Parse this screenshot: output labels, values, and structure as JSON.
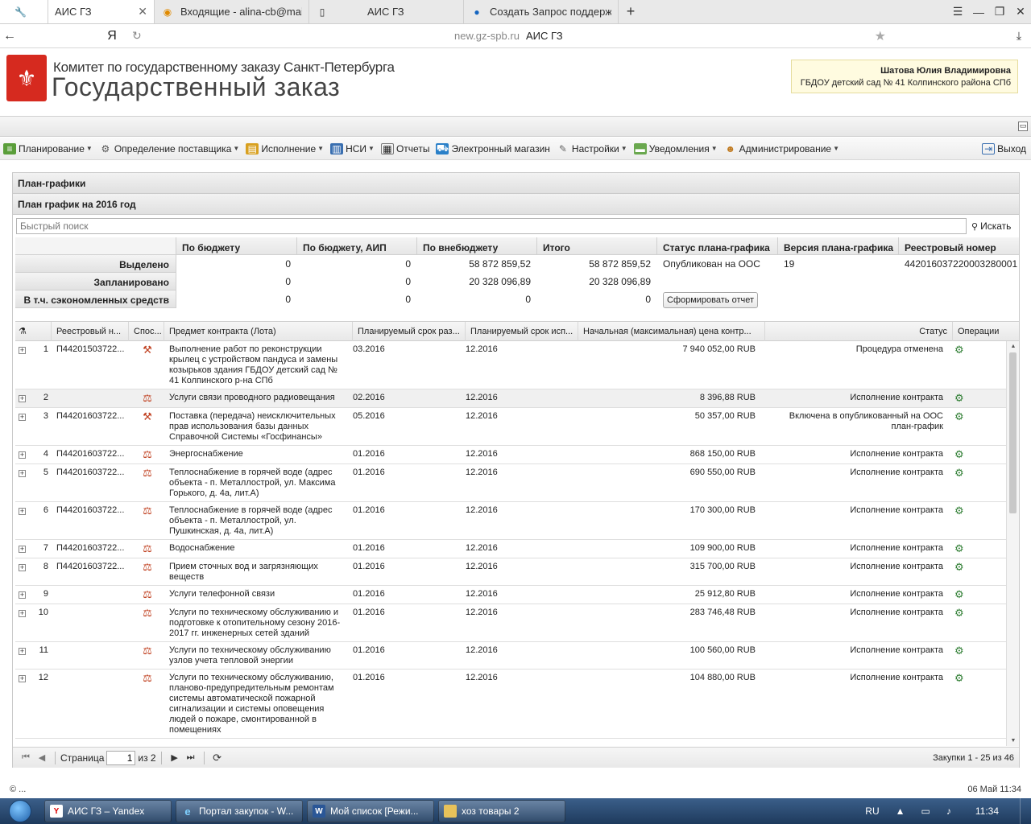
{
  "browser": {
    "tabs": [
      {
        "label": "АИС ГЗ",
        "icon": "wrench-icon",
        "active": true
      },
      {
        "label": "Входящие - alina-cb@mail.ru",
        "icon": "mail-icon"
      },
      {
        "label": "АИС ГЗ",
        "icon": "page-icon"
      },
      {
        "label": "Создать Запрос поддержки",
        "icon": "help-icon"
      }
    ],
    "yandex_glyph": "Я",
    "url_host": "new.gz-spb.ru",
    "url_title": "АИС ГЗ"
  },
  "header": {
    "org": "Комитет по государственному заказу Санкт-Петербурга",
    "brand": "Государственный заказ",
    "user_name": "Шатова Юлия Владимировна",
    "user_org": "ГБДОУ детский сад № 41 Колпинского района СПб"
  },
  "menu": {
    "items": [
      {
        "label": "Планирование",
        "icon": "planning-icon",
        "dropdown": true
      },
      {
        "label": "Определение поставщика",
        "icon": "supplier-icon",
        "dropdown": true
      },
      {
        "label": "Исполнение",
        "icon": "execution-icon",
        "dropdown": true
      },
      {
        "label": "НСИ",
        "icon": "book-icon",
        "dropdown": true
      },
      {
        "label": "Отчеты",
        "icon": "report-icon",
        "dropdown": false
      },
      {
        "label": "Электронный магазин",
        "icon": "cart-icon",
        "dropdown": false
      },
      {
        "label": "Настройки",
        "icon": "wrench-icon",
        "dropdown": true
      },
      {
        "label": "Уведомления",
        "icon": "notification-icon",
        "dropdown": true
      },
      {
        "label": "Администрирование",
        "icon": "user-icon",
        "dropdown": true
      }
    ],
    "exit_label": "Выход"
  },
  "panel": {
    "title": "План-графики",
    "subtitle": "План график на 2016 год",
    "search_placeholder": "Быстрый поиск",
    "search_button": "Искать"
  },
  "summary": {
    "headers": [
      "По бюджету",
      "По бюджету, АИП",
      "По внебюджету",
      "Итого",
      "Статус плана-графика",
      "Версия плана-графика",
      "Реестровый номер"
    ],
    "rows": [
      {
        "label": "Выделено",
        "values": [
          "0",
          "0",
          "58 872 859,52",
          "58 872 859,52"
        ]
      },
      {
        "label": "Запланировано",
        "values": [
          "0",
          "0",
          "20 328 096,89",
          "20 328 096,89"
        ]
      },
      {
        "label": "В т.ч. сэкономленных средств",
        "values": [
          "0",
          "0",
          "0",
          "0"
        ]
      }
    ],
    "status": "Опубликован на ООС",
    "version": "19",
    "registry_number": "442016037220003280001",
    "report_button": "Сформировать отчет"
  },
  "grid": {
    "columns": [
      "Реестровый н...",
      "Спос...",
      "Предмет контракта (Лота)",
      "Планируемый срок раз...",
      "Планируемый срок исп...",
      "Начальная (максимальная) цена контр...",
      "Статус",
      "Операции"
    ],
    "rows": [
      {
        "n": "1",
        "reg": "П44201503722...",
        "method": "auction-icon",
        "subject": "Выполнение работ по реконструкции крылец с устройством пандуса и замены козырьков здания ГБДОУ детский сад № 41 Колпинского р-на СПб",
        "start": "03.2016",
        "end": "12.2016",
        "price": "7 940 052,00 RUB",
        "status": "Процедура отменена"
      },
      {
        "n": "2",
        "reg": "",
        "method": "single-supplier-icon",
        "subject": "Услуги связи проводного радиовещания",
        "start": "02.2016",
        "end": "12.2016",
        "price": "8 396,88 RUB",
        "status": "Исполнение контракта"
      },
      {
        "n": "3",
        "reg": "П44201603722...",
        "method": "auction-icon",
        "subject": "Поставка (передача) неисключительных прав использования базы данных Справочной Системы «Госфинансы»",
        "start": "05.2016",
        "end": "12.2016",
        "price": "50 357,00 RUB",
        "status": "Включена в опубликованный на ООС план-график"
      },
      {
        "n": "4",
        "reg": "П44201603722...",
        "method": "single-supplier-icon",
        "subject": "Энергоснабжение",
        "start": "01.2016",
        "end": "12.2016",
        "price": "868 150,00 RUB",
        "status": "Исполнение контракта"
      },
      {
        "n": "5",
        "reg": "П44201603722...",
        "method": "single-supplier-icon",
        "subject": "Теплоснабжение в горячей воде (адрес объекта - п. Металлострой, ул. Максима Горького, д. 4а, лит.А)",
        "start": "01.2016",
        "end": "12.2016",
        "price": "690 550,00 RUB",
        "status": "Исполнение контракта"
      },
      {
        "n": "6",
        "reg": "П44201603722...",
        "method": "single-supplier-icon",
        "subject": "Теплоснабжение в горячей воде (адрес объекта - п. Металлострой, ул. Пушкинская, д. 4а, лит.А)",
        "start": "01.2016",
        "end": "12.2016",
        "price": "170 300,00 RUB",
        "status": "Исполнение контракта"
      },
      {
        "n": "7",
        "reg": "П44201603722...",
        "method": "single-supplier-icon",
        "subject": "Водоснабжение",
        "start": "01.2016",
        "end": "12.2016",
        "price": "109 900,00 RUB",
        "status": "Исполнение контракта"
      },
      {
        "n": "8",
        "reg": "П44201603722...",
        "method": "single-supplier-icon",
        "subject": "Прием сточных вод и загрязняющих веществ",
        "start": "01.2016",
        "end": "12.2016",
        "price": "315 700,00 RUB",
        "status": "Исполнение контракта"
      },
      {
        "n": "9",
        "reg": "",
        "method": "single-supplier-icon",
        "subject": "Услуги телефонной связи",
        "start": "01.2016",
        "end": "12.2016",
        "price": "25 912,80 RUB",
        "status": "Исполнение контракта"
      },
      {
        "n": "10",
        "reg": "",
        "method": "single-supplier-icon",
        "subject": "Услуги по техническому обслуживанию и подготовке к отопительному сезону 2016-2017 гг. инженерных сетей зданий",
        "start": "01.2016",
        "end": "12.2016",
        "price": "283 746,48 RUB",
        "status": "Исполнение контракта"
      },
      {
        "n": "11",
        "reg": "",
        "method": "single-supplier-icon",
        "subject": "Услуги по техническому обслуживанию узлов учета тепловой энергии",
        "start": "01.2016",
        "end": "12.2016",
        "price": "100 560,00 RUB",
        "status": "Исполнение контракта"
      },
      {
        "n": "12",
        "reg": "",
        "method": "single-supplier-icon",
        "subject": "Услуги по техническому обслуживанию, планово-предупредительным ремонтам системы автоматической пожарной сигнализации и системы оповещения людей о пожаре, смонтированной в помещениях",
        "start": "01.2016",
        "end": "12.2016",
        "price": "104 880,00 RUB",
        "status": "Исполнение контракта"
      }
    ]
  },
  "pager": {
    "page_label": "Страница",
    "page_value": "1",
    "of_label": "из 2",
    "info": "Закупки 1 - 25 из 46"
  },
  "footer": {
    "copyright": "© ...",
    "datetime": "06 Май 11:34"
  },
  "taskbar": {
    "tasks": [
      {
        "label": "АИС ГЗ – Yandex",
        "icon": "yandex-icon"
      },
      {
        "label": "Портал закупок - W...",
        "icon": "ie-icon"
      },
      {
        "label": "Мой список [Режи...",
        "icon": "word-icon"
      },
      {
        "label": "хоз товары 2",
        "icon": "folder-icon"
      }
    ],
    "lang": "RU",
    "clock": "11:34"
  }
}
